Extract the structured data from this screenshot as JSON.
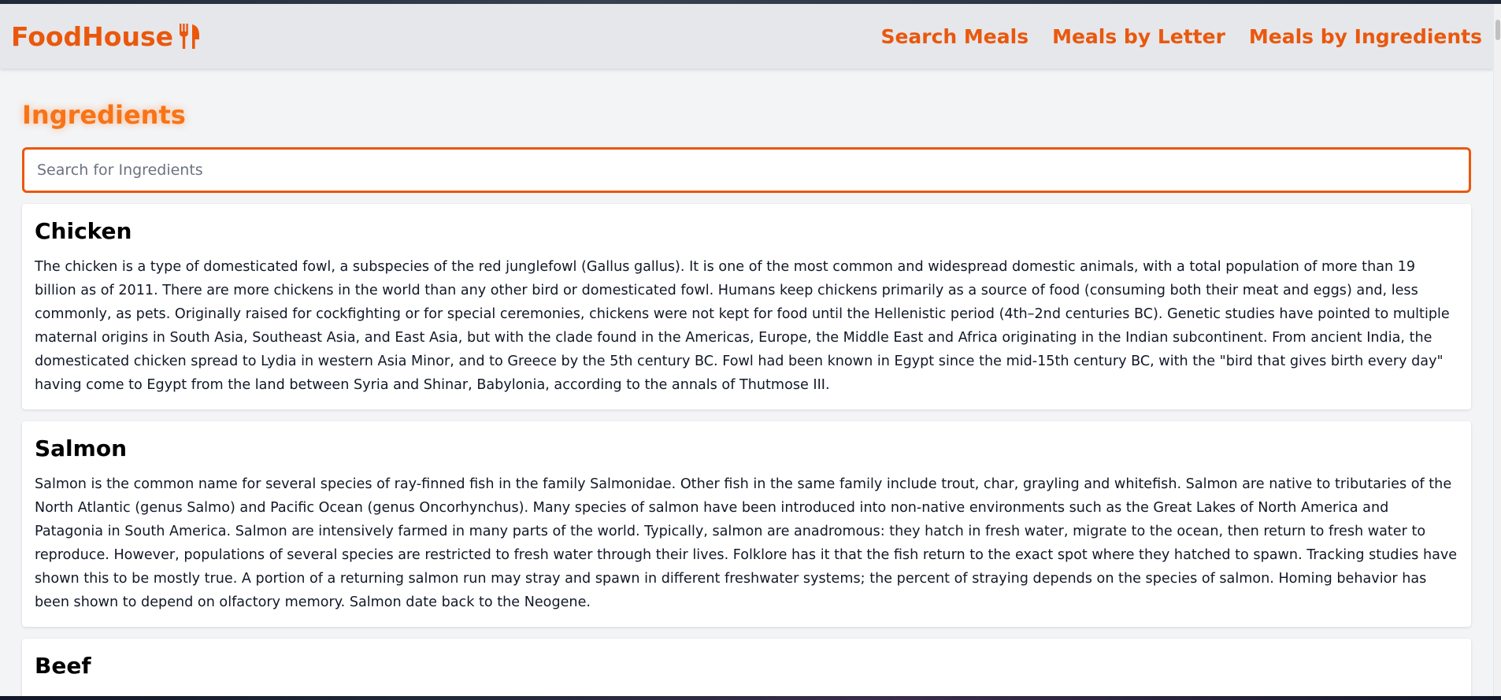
{
  "header": {
    "logo_text": "FoodHouse",
    "logo_icon": "utensils-icon",
    "nav": [
      {
        "label": "Search Meals"
      },
      {
        "label": "Meals by Letter"
      },
      {
        "label": "Meals by Ingredients"
      }
    ]
  },
  "page": {
    "title": "Ingredients"
  },
  "search": {
    "placeholder": "Search for Ingredients",
    "value": ""
  },
  "ingredients": [
    {
      "name": "Chicken",
      "description": "The chicken is a type of domesticated fowl, a subspecies of the red junglefowl (Gallus gallus). It is one of the most common and widespread domestic animals, with a total population of more than 19 billion as of 2011. There are more chickens in the world than any other bird or domesticated fowl. Humans keep chickens primarily as a source of food (consuming both their meat and eggs) and, less commonly, as pets. Originally raised for cockfighting or for special ceremonies, chickens were not kept for food until the Hellenistic period (4th–2nd centuries BC). Genetic studies have pointed to multiple maternal origins in South Asia, Southeast Asia, and East Asia, but with the clade found in the Americas, Europe, the Middle East and Africa originating in the Indian subcontinent. From ancient India, the domesticated chicken spread to Lydia in western Asia Minor, and to Greece by the 5th century BC. Fowl had been known in Egypt since the mid-15th century BC, with the \"bird that gives birth every day\" having come to Egypt from the land between Syria and Shinar, Babylonia, according to the annals of Thutmose III."
    },
    {
      "name": "Salmon",
      "description": "Salmon is the common name for several species of ray-finned fish in the family Salmonidae. Other fish in the same family include trout, char, grayling and whitefish. Salmon are native to tributaries of the North Atlantic (genus Salmo) and Pacific Ocean (genus Oncorhynchus). Many species of salmon have been introduced into non-native environments such as the Great Lakes of North America and Patagonia in South America. Salmon are intensively farmed in many parts of the world. Typically, salmon are anadromous: they hatch in fresh water, migrate to the ocean, then return to fresh water to reproduce. However, populations of several species are restricted to fresh water through their lives. Folklore has it that the fish return to the exact spot where they hatched to spawn. Tracking studies have shown this to be mostly true. A portion of a returning salmon run may stray and spawn in different freshwater systems; the percent of straying depends on the species of salmon. Homing behavior has been shown to depend on olfactory memory. Salmon date back to the Neogene."
    },
    {
      "name": "Beef",
      "description": ""
    }
  ],
  "colors": {
    "accent": "#ea580c",
    "title": "#f97316",
    "header_bg": "#e5e7eb",
    "page_bg": "#f3f4f6"
  }
}
